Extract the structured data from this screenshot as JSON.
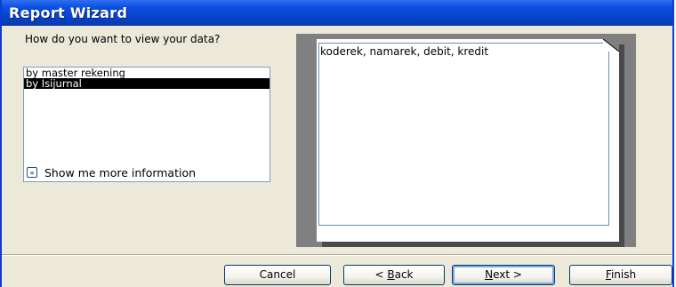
{
  "window": {
    "title": "Report Wizard"
  },
  "prompt": {
    "question": "How do you want to view your data?"
  },
  "view_list": {
    "items": [
      {
        "label": "by master rekening",
        "selected": false
      },
      {
        "label": "by Isijurnal",
        "selected": true
      }
    ]
  },
  "info": {
    "icon": "double-chevron-icon",
    "label": "Show me more information"
  },
  "preview": {
    "fields": "koderek, namarek, debit, kredit"
  },
  "buttons": {
    "cancel": "Cancel",
    "back_prefix": "< ",
    "back_mnemonic": "B",
    "back_rest": "ack",
    "next_mnemonic": "N",
    "next_rest": "ext >",
    "finish_mnemonic": "F",
    "finish_rest": "inish"
  }
}
